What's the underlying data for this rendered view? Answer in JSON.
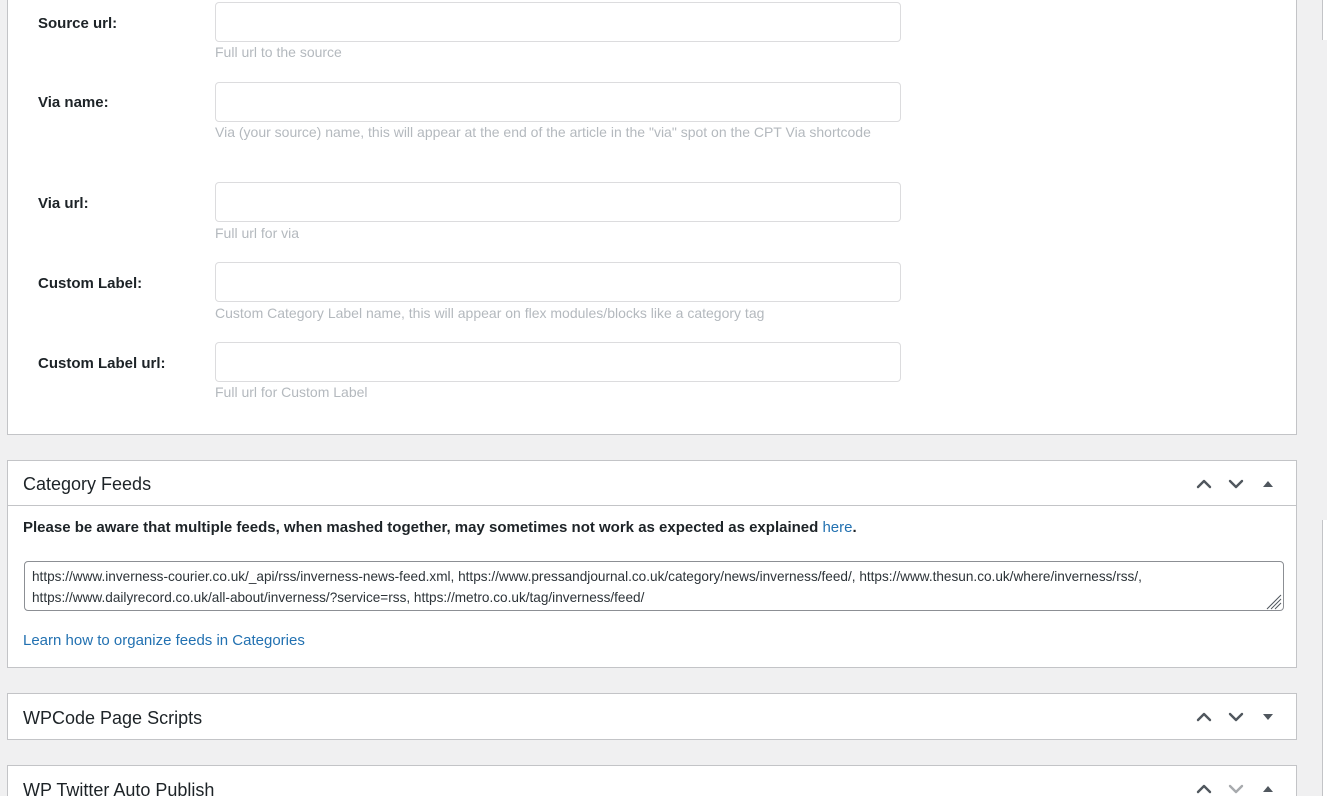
{
  "source_fields": [
    {
      "label": "Source url:",
      "value": "",
      "description": "Full url to the source"
    },
    {
      "label": "Via name:",
      "value": "",
      "description": "Via (your source) name, this will appear at the end of the article in the \"via\" spot on the CPT Via shortcode"
    },
    {
      "label": "Via url:",
      "value": "",
      "description": "Full url for via"
    },
    {
      "label": "Custom Label:",
      "value": "",
      "description": "Custom Category Label name, this will appear on flex modules/blocks like a category tag"
    },
    {
      "label": "Custom Label url:",
      "value": "",
      "description": "Full url for Custom Label"
    }
  ],
  "category_feeds": {
    "title": "Category Feeds",
    "notice_text": "Please be aware that multiple feeds, when mashed together, may sometimes not work as expected as explained ",
    "notice_link": "here",
    "notice_end": ".",
    "feeds_value": "https://www.inverness-courier.co.uk/_api/rss/inverness-news-feed.xml, https://www.pressandjournal.co.uk/category/news/inverness/feed/, https://www.thesun.co.uk/where/inverness/rss/, https://www.dailyrecord.co.uk/all-about/inverness/?service=rss, https://metro.co.uk/tag/inverness/feed/",
    "learn_link": "Learn how to organize feeds in Categories"
  },
  "wpcode": {
    "title": "WPCode Page Scripts"
  },
  "twitter": {
    "title": "WP Twitter Auto Publish"
  },
  "icons": {
    "move_up": "chevron-up-icon",
    "move_down": "chevron-down-icon",
    "toggle_expanded": "triangle-up-icon",
    "toggle_collapsed": "triangle-down-icon"
  },
  "colors": {
    "link": "#2271b1",
    "description": "#b4b9be",
    "border": "#c3c4c7",
    "background": "#f0f0f1"
  }
}
